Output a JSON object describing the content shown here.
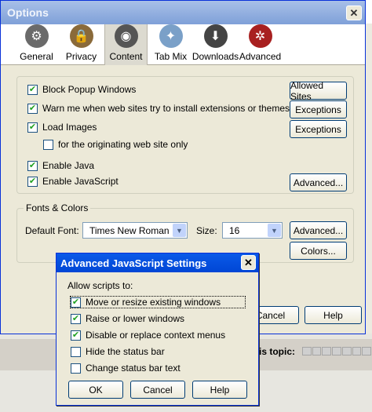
{
  "window": {
    "title": "Options",
    "close_glyph": "✕"
  },
  "toolbar": {
    "items": [
      {
        "label": "General",
        "icon": "general-icon",
        "color": "#6a6a6a",
        "glyph": "⚙"
      },
      {
        "label": "Privacy",
        "icon": "privacy-icon",
        "color": "#8a6a3a",
        "glyph": "🔒"
      },
      {
        "label": "Content",
        "icon": "content-icon",
        "color": "#555555",
        "glyph": "◉",
        "selected": true
      },
      {
        "label": "Tab Mix",
        "icon": "tab-mix-icon",
        "color": "#7aa0c8",
        "glyph": "✦"
      },
      {
        "label": "Downloads",
        "icon": "downloads-icon",
        "color": "#444444",
        "glyph": "⬇"
      },
      {
        "label": "Advanced",
        "icon": "advanced-icon",
        "color": "#a82020",
        "glyph": "✲"
      }
    ]
  },
  "content": {
    "block_popups": {
      "label": "Block Popup Windows",
      "checked": true
    },
    "allowed_sites": "Allowed Sites",
    "warn_extensions": {
      "label": "Warn me when web sites try to install extensions or themes",
      "checked": true
    },
    "exceptions1": "Exceptions",
    "load_images": {
      "label": "Load Images",
      "checked": true
    },
    "exceptions2": "Exceptions",
    "originating_only": {
      "label": "for the originating web site only",
      "checked": false
    },
    "enable_java": {
      "label": "Enable Java",
      "checked": true
    },
    "enable_javascript": {
      "label": "Enable JavaScript",
      "checked": true
    },
    "advanced_js": "Advanced...",
    "fonts_legend": "Fonts & Colors",
    "default_font_label": "Default Font:",
    "default_font_value": "Times New Roman",
    "size_label": "Size:",
    "size_value": "16",
    "advanced_fonts": "Advanced...",
    "colors": "Colors..."
  },
  "bottom_buttons": {
    "cancel": "Cancel",
    "help": "Help"
  },
  "background": {
    "topic_text": "is topic:"
  },
  "dialog": {
    "title": "Advanced JavaScript Settings",
    "close_glyph": "✕",
    "allow_label": "Allow scripts to:",
    "options": [
      {
        "label": "Move or resize existing windows",
        "checked": true
      },
      {
        "label": "Raise or lower windows",
        "checked": true
      },
      {
        "label": "Disable or replace context menus",
        "checked": true
      },
      {
        "label": "Hide the status bar",
        "checked": false
      },
      {
        "label": "Change status bar text",
        "checked": false
      }
    ],
    "ok": "OK",
    "cancel": "Cancel",
    "help": "Help"
  }
}
